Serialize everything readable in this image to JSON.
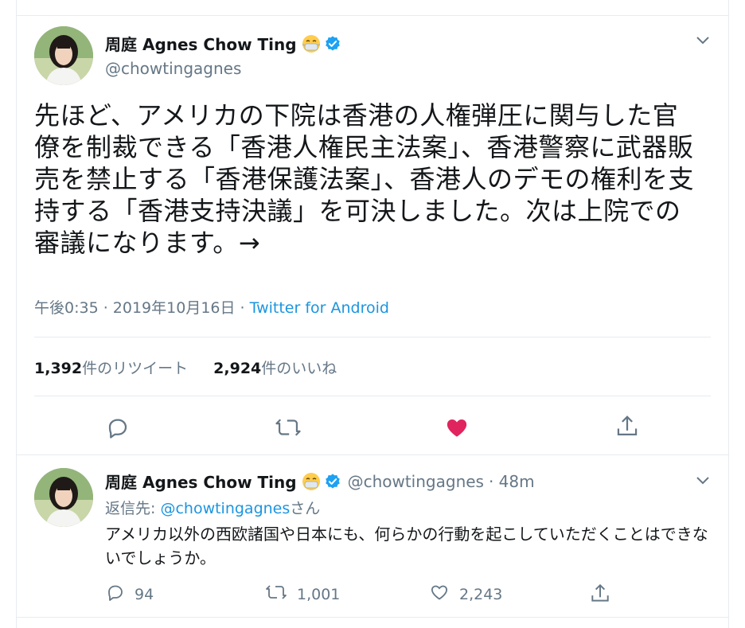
{
  "main_tweet": {
    "author_name": "周庭 Agnes Chow Ting",
    "author_handle": "@chowtingagnes",
    "text": "先ほど、アメリカの下院は香港の人権弾圧に関与した官僚を制裁できる「香港人権民主法案」、香港警察に武器販売を禁止する「香港保護法案」、香港人のデモの権利を支持する「香港支持決議」を可決しました。次は上院での審議になります。→",
    "time": "午後0:35 · 2019年10月16日 · ",
    "source": "Twitter for Android",
    "retweets_count": "1,392",
    "retweets_label": "件のリツイート",
    "likes_count": "2,924",
    "likes_label": "件のいいね",
    "like_color": "#e0245e"
  },
  "reply_tweet": {
    "author_name": "周庭 Agnes Chow Ting",
    "author_handle": "@chowtingagnes",
    "age": "· 48m",
    "reply_prefix": "返信先: ",
    "reply_mention": "@chowtingagnes",
    "reply_suffix": "さん",
    "text": "アメリカ以外の西欧諸国や日本にも、何らかの行動を起こしていただくことはできないでしょうか。",
    "replies": "94",
    "retweets": "1,001",
    "likes": "2,243"
  },
  "colors": {
    "link": "#1b95e0",
    "muted": "#657786",
    "verified": "#1da1f2"
  },
  "icons": [
    "chevron-down-icon",
    "verified-badge-icon",
    "mask-emoji-icon",
    "reply-icon",
    "retweet-icon",
    "heart-icon",
    "share-icon"
  ]
}
